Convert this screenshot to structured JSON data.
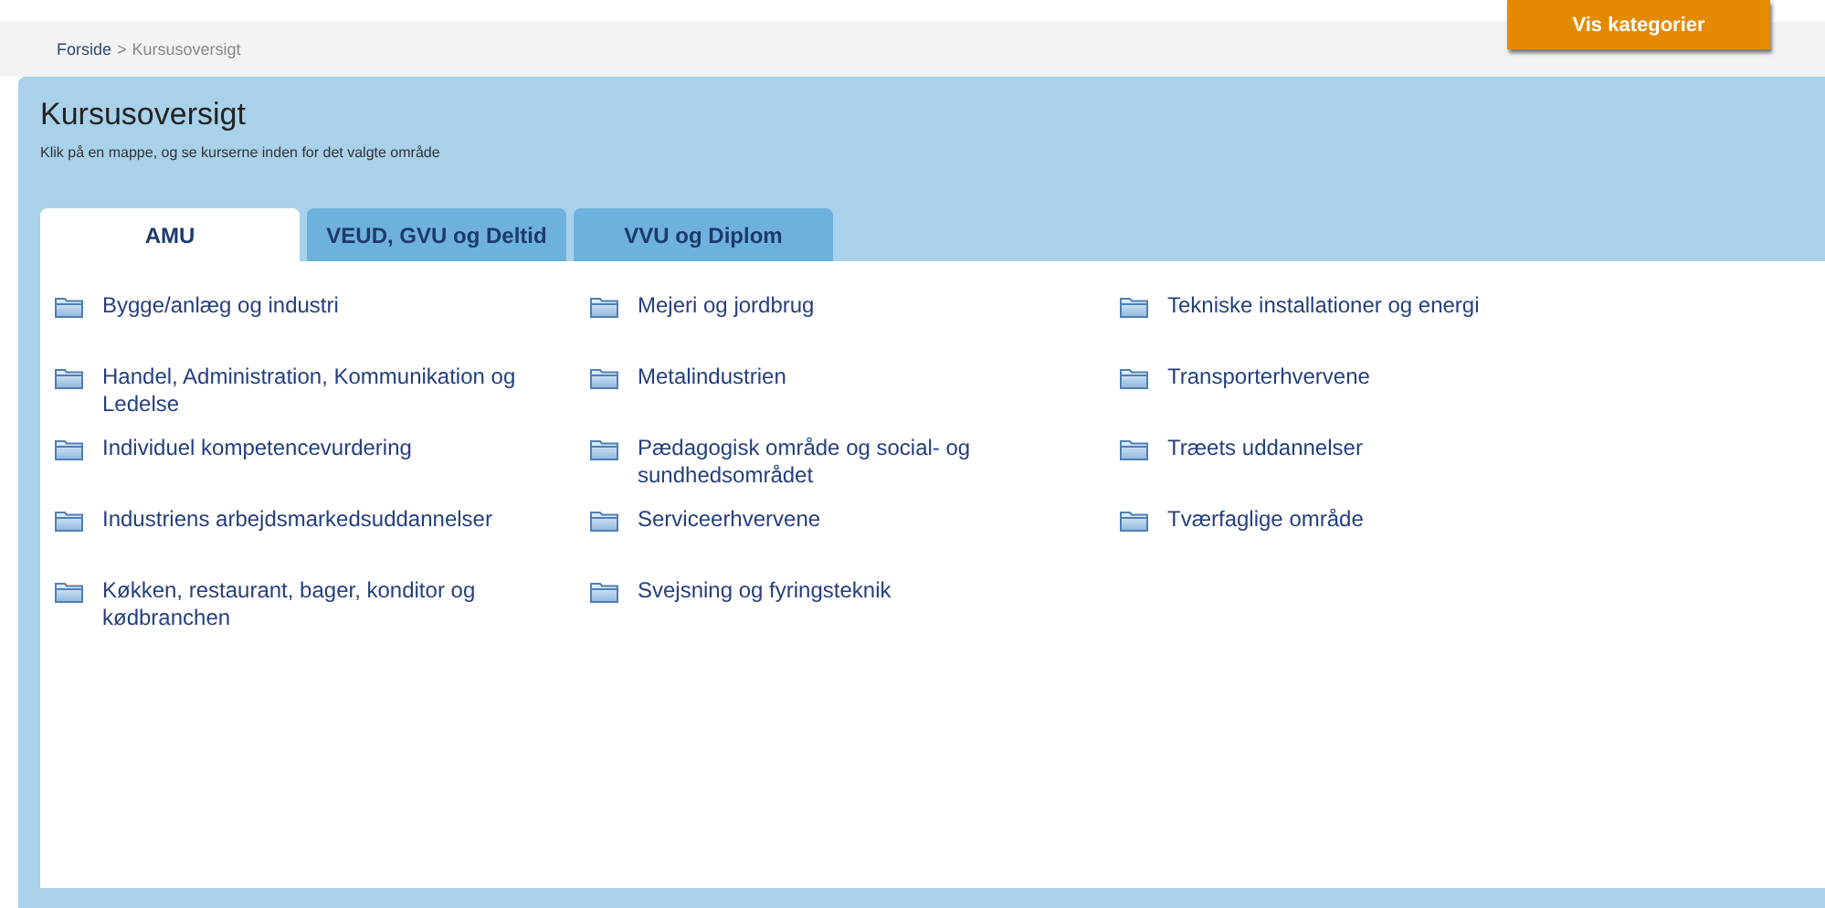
{
  "breadcrumb": [
    {
      "label": "Forside",
      "kind": "link"
    },
    {
      "label": ">",
      "kind": "separator"
    },
    {
      "label": "Kursusoversigt",
      "kind": "current"
    }
  ],
  "top_button": {
    "label": "Vis kategorier"
  },
  "title": "Kursusoversigt",
  "subtitle": "Klik på en mappe, og se kurserne inden for det valgte område",
  "tabs": [
    {
      "label": "AMU",
      "selected": true
    },
    {
      "label": "VEUD, GVU og Deltid",
      "selected": false
    },
    {
      "label": "VVU og Diplom",
      "selected": false
    }
  ],
  "folders": [
    {
      "label": "Bygge/anlæg og industri"
    },
    {
      "label": "Handel, Administration, Kommunikation og Ledelse"
    },
    {
      "label": "Individuel kompetencevurdering"
    },
    {
      "label": "Industriens arbejdsmarkedsuddannelser"
    },
    {
      "label": "Køkken, restaurant, bager, konditor og kødbranchen"
    },
    {
      "label": "Mejeri og jordbrug"
    },
    {
      "label": "Metalindustrien"
    },
    {
      "label": "Pædagogisk område og social- og sundhedsområdet"
    },
    {
      "label": "Serviceerhvervene"
    },
    {
      "label": "Svejsning og fyringsteknik"
    },
    {
      "label": "Tekniske installationer og energi"
    },
    {
      "label": "Transporterhvervene"
    },
    {
      "label": "Træets uddannelser"
    },
    {
      "label": "Tværfaglige område"
    }
  ]
}
